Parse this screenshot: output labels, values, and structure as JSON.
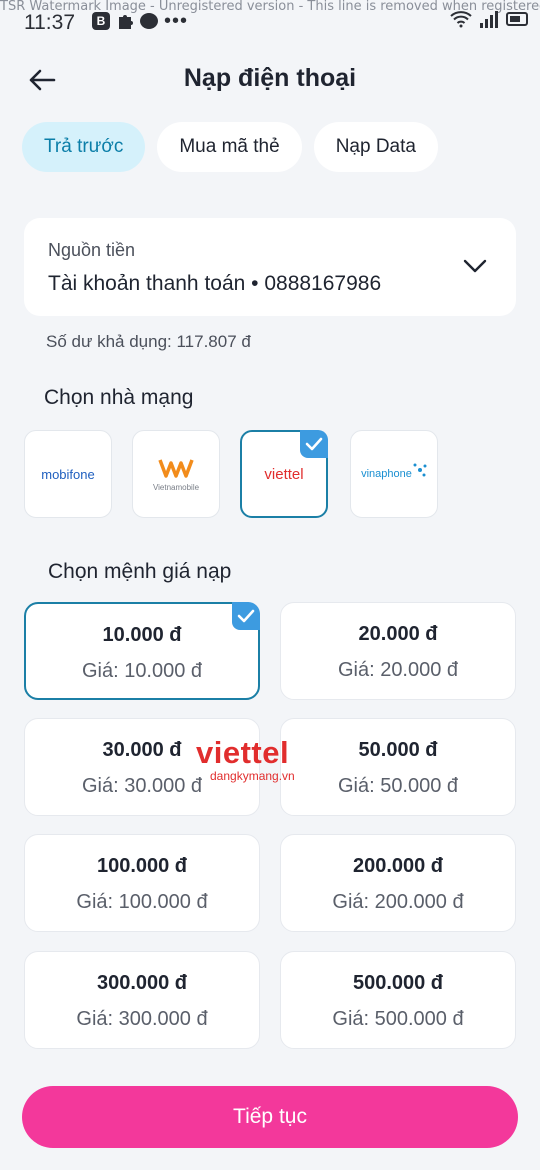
{
  "status_bar": {
    "watermark": "TSR Watermark Image - Unregistered version - This line is removed when registered",
    "time": "11:37",
    "badge": "B",
    "dots": "•••"
  },
  "header": {
    "title": "Nạp điện thoại"
  },
  "tabs": [
    {
      "label": "Trả trước",
      "active": true
    },
    {
      "label": "Mua mã thẻ",
      "active": false
    },
    {
      "label": "Nạp Data",
      "active": false
    }
  ],
  "source": {
    "label": "Nguồn tiền",
    "value": "Tài khoản thanh toán • 0888167986"
  },
  "balance_text": "Số dư khả dụng: 117.807 đ",
  "carrier_section_title": "Chọn nhà mạng",
  "carriers": [
    {
      "name": "mobifone",
      "selected": false,
      "color": "#1f5fbf"
    },
    {
      "name": "Vietnamobile",
      "selected": false,
      "color": "#f28c1c"
    },
    {
      "name": "viettel",
      "selected": true,
      "color": "#e12d2d"
    },
    {
      "name": "vinaphone",
      "selected": false,
      "color": "#1a8fd1"
    }
  ],
  "denom_section_title": "Chọn mệnh giá nạp",
  "denominations": [
    {
      "amount": "10.000 đ",
      "price": "Giá: 10.000 đ",
      "selected": true
    },
    {
      "amount": "20.000 đ",
      "price": "Giá: 20.000 đ",
      "selected": false
    },
    {
      "amount": "30.000 đ",
      "price": "Giá: 30.000 đ",
      "selected": false
    },
    {
      "amount": "50.000 đ",
      "price": "Giá: 50.000 đ",
      "selected": false
    },
    {
      "amount": "100.000 đ",
      "price": "Giá: 100.000 đ",
      "selected": false
    },
    {
      "amount": "200.000 đ",
      "price": "Giá: 200.000 đ",
      "selected": false
    },
    {
      "amount": "300.000 đ",
      "price": "Giá: 300.000 đ",
      "selected": false
    },
    {
      "amount": "500.000 đ",
      "price": "Giá: 500.000 đ",
      "selected": false
    }
  ],
  "overlay_watermark": {
    "brand": "viettel",
    "sub": "dangkymang.vn"
  },
  "continue_label": "Tiếp tục",
  "colors": {
    "accent": "#f3389b",
    "selected_border": "#1b7fa6",
    "check": "#3d9be0",
    "active_tab_bg": "#d5f1fb"
  }
}
